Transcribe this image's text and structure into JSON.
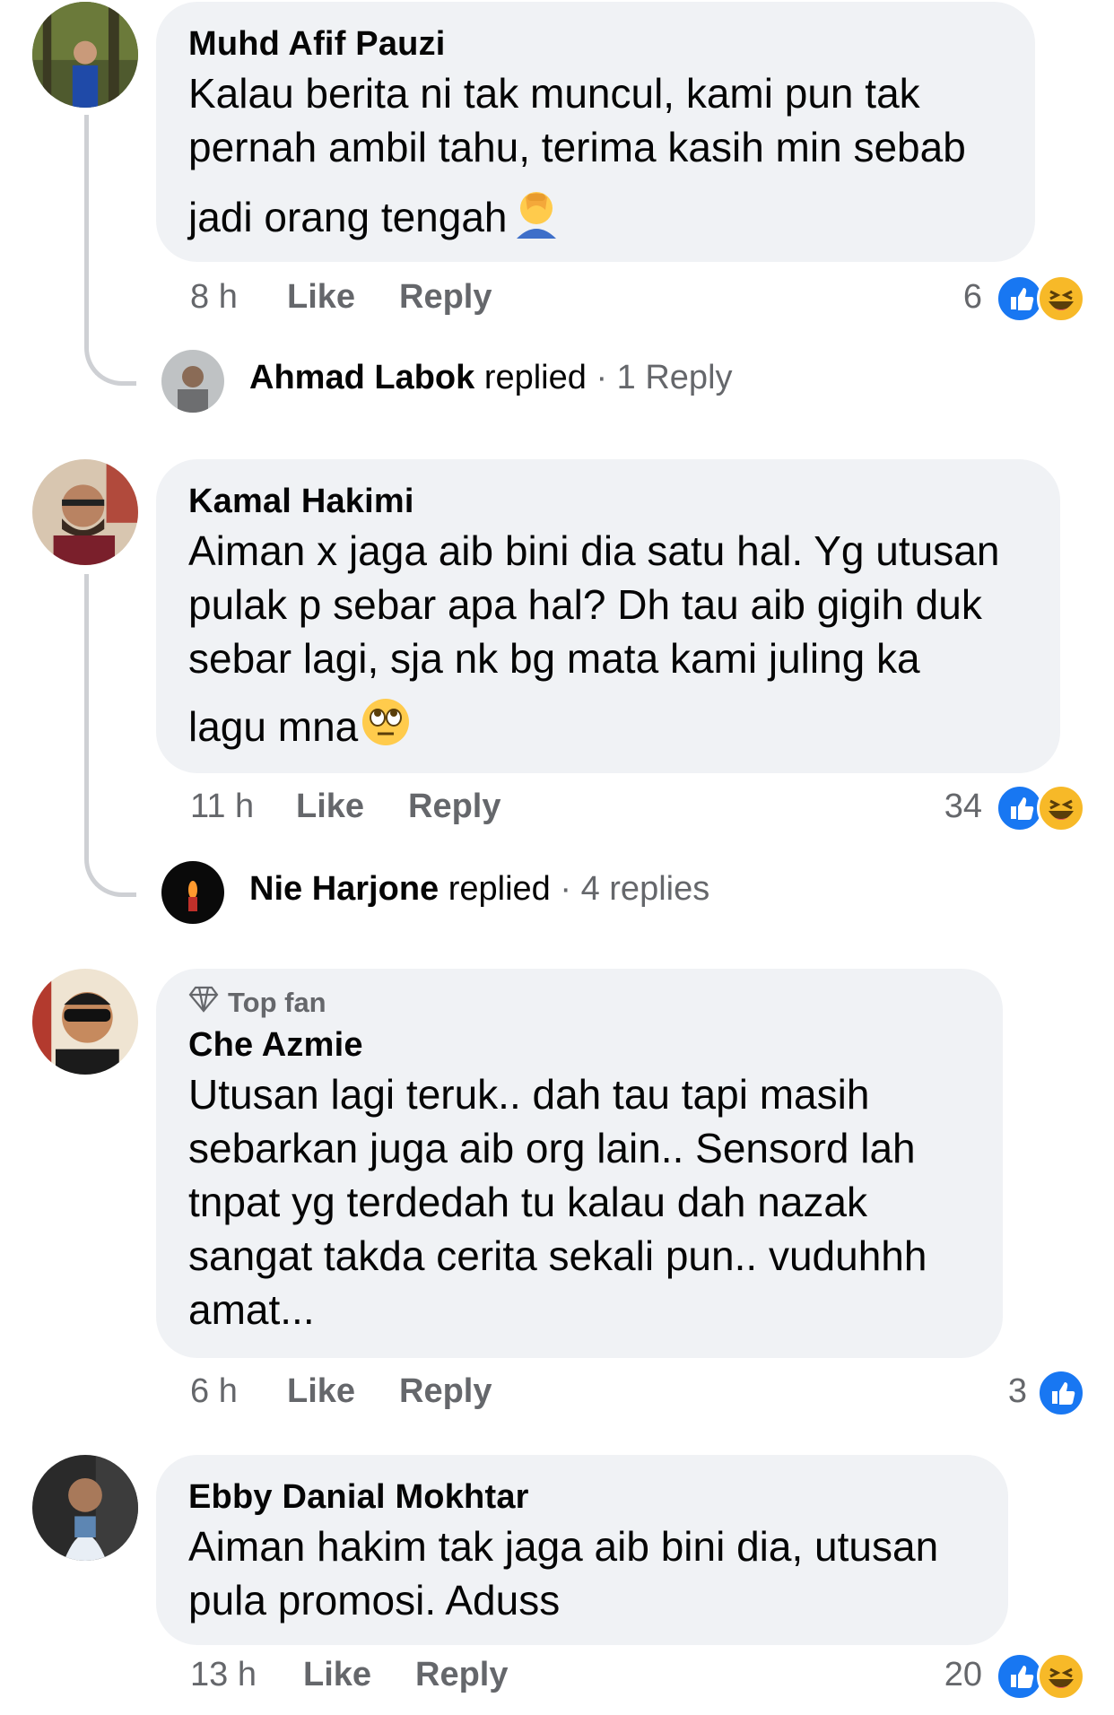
{
  "comments": [
    {
      "author": "Muhd Afif Pauzi",
      "text_lines": [
        "Kalau berita ni tak muncul, kami pun tak",
        "pernah ambil tahu, terima kasih min sebab",
        "jadi orang tengah"
      ],
      "time": "8 h",
      "like_label": "Like",
      "reply_label": "Reply",
      "reaction_count": "6",
      "reactions": [
        "like-icon",
        "haha-icon"
      ],
      "trailing_emoji": "facepalm-emoji",
      "replies": {
        "name": "Ahmad Labok",
        "replied": "replied",
        "count": "· 1 Reply"
      }
    },
    {
      "author": "Kamal Hakimi",
      "text_lines": [
        "Aiman x jaga aib bini dia satu hal. Yg utusan",
        "pulak p sebar apa hal? Dh tau aib gigih duk",
        "sebar lagi, sja nk bg mata kami juling ka",
        "lagu mna"
      ],
      "time": "11 h",
      "like_label": "Like",
      "reply_label": "Reply",
      "reaction_count": "34",
      "reactions": [
        "like-icon",
        "haha-icon"
      ],
      "trailing_emoji": "eye-roll-emoji",
      "replies": {
        "name": "Nie Harjone",
        "replied": "replied",
        "count": "· 4 replies"
      }
    },
    {
      "badge": "Top fan",
      "author": "Che Azmie",
      "text_lines": [
        "Utusan lagi teruk.. dah tau tapi masih",
        "sebarkan juga aib org lain.. Sensord lah",
        "tnpat yg terdedah tu kalau dah nazak",
        "sangat takda cerita sekali pun.. vuduhhh",
        "amat..."
      ],
      "time": "6 h",
      "like_label": "Like",
      "reply_label": "Reply",
      "reaction_count": "3",
      "reactions": [
        "like-icon"
      ]
    },
    {
      "author": "Ebby Danial Mokhtar",
      "text_lines": [
        "Aiman hakim tak jaga aib bini dia, utusan",
        "pula promosi. Aduss"
      ],
      "time": "13 h",
      "like_label": "Like",
      "reply_label": "Reply",
      "reaction_count": "20",
      "reactions": [
        "like-icon",
        "haha-icon"
      ]
    }
  ],
  "colors": {
    "bubble": "#f0f2f5",
    "muted": "#65676b",
    "like_blue": "#1877f2",
    "haha_yellow": "#f7b928",
    "thread_line": "#ced0d4"
  }
}
